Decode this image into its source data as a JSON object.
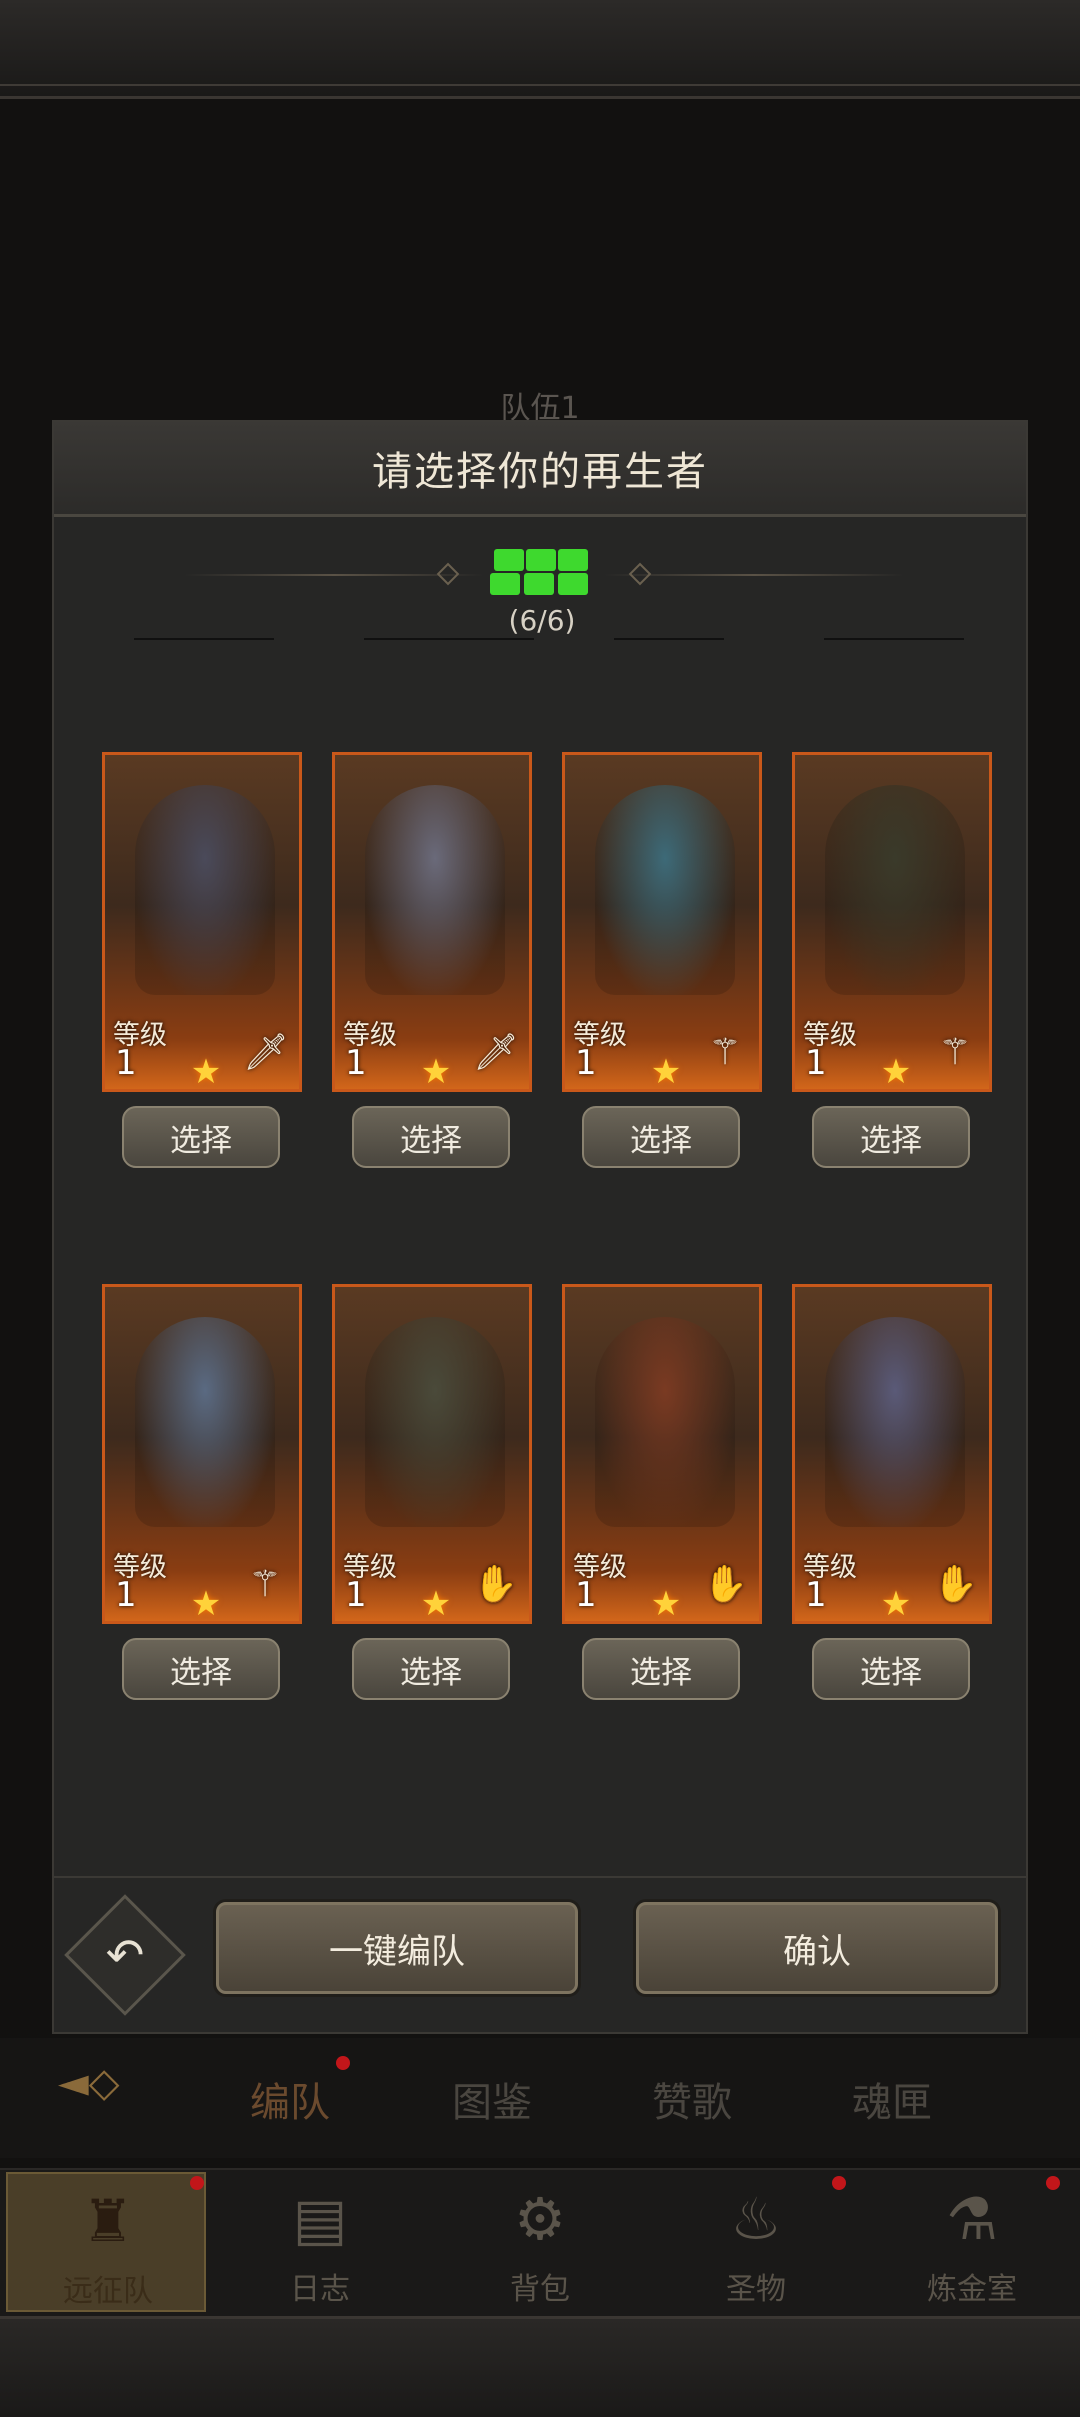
{
  "background": {
    "team_title": "队伍1"
  },
  "modal": {
    "title": "请选择你的再生者",
    "team_count": "(6/6)",
    "heroes": [
      {
        "level_label": "等级",
        "level": "1",
        "class_icon": "sword-icon",
        "portrait": "werewolf",
        "tint": "#4a4a5a"
      },
      {
        "level_label": "等级",
        "level": "1",
        "class_icon": "sword-icon",
        "portrait": "elf-engineer",
        "tint": "#6a6a7a"
      },
      {
        "level_label": "等级",
        "level": "1",
        "class_icon": "staff-icon",
        "portrait": "sea-priestess",
        "tint": "#3d6a78"
      },
      {
        "level_label": "等级",
        "level": "1",
        "class_icon": "staff-icon",
        "portrait": "bearded-mage",
        "tint": "#3a3a2a"
      },
      {
        "level_label": "等级",
        "level": "1",
        "class_icon": "staff-icon",
        "portrait": "silver-hair-sorceress",
        "tint": "#5a6a82"
      },
      {
        "level_label": "等级",
        "level": "1",
        "class_icon": "hand-icon",
        "portrait": "hooded-oracle",
        "tint": "#4a4a3a"
      },
      {
        "level_label": "等级",
        "level": "1",
        "class_icon": "hand-icon",
        "portrait": "red-hair-warrior",
        "tint": "#7a3a22"
      },
      {
        "level_label": "等级",
        "level": "1",
        "class_icon": "hand-icon",
        "portrait": "blonde-witch",
        "tint": "#5a5a78"
      }
    ],
    "select_label": "选择",
    "auto_team_label": "一键编队",
    "confirm_label": "确认"
  },
  "tabs": [
    {
      "label": "编队",
      "active": true
    },
    {
      "label": "图鉴",
      "active": false
    },
    {
      "label": "赞歌",
      "active": false
    },
    {
      "label": "魂匣",
      "active": false
    }
  ],
  "nav": [
    {
      "label": "远征队",
      "icon": "helmet-icon",
      "active": true
    },
    {
      "label": "日志",
      "icon": "scroll-icon",
      "active": false
    },
    {
      "label": "背包",
      "icon": "bag-icon",
      "active": false
    },
    {
      "label": "圣物",
      "icon": "torch-icon",
      "active": false
    },
    {
      "label": "炼金室",
      "icon": "alchemy-icon",
      "active": false
    }
  ],
  "colors": {
    "accent": "#c9581a",
    "team_green": "#3ed92e",
    "badge_red": "#c2161a"
  }
}
